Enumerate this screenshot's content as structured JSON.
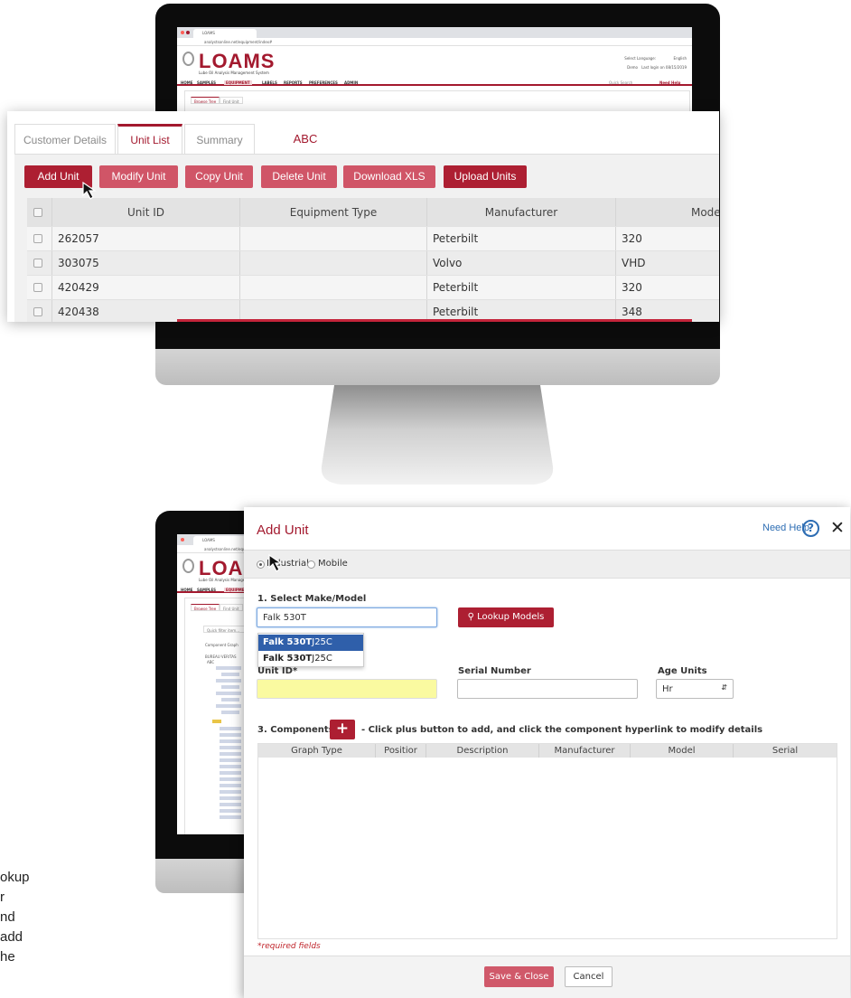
{
  "mini_browser": {
    "tab_label": "LOAMS",
    "url": "analystsonline.net/equipment/index#",
    "logo_text": "LOAMS",
    "logo_subtitle": "Lube Oil Analysis Management System",
    "language_label": "Select Language:",
    "language_value": "English",
    "user_label": "Demo",
    "last_login": "Last login on 08/15/2019",
    "quick_search": "Quick Search",
    "need_help": "Need Help",
    "nav": [
      "HOME",
      "SAMPLES",
      "EQUIPMENT",
      "LABELS",
      "REPORTS",
      "PREFERENCES",
      "ADMIN"
    ],
    "sub_tabs": [
      "Browse Tree",
      "Find Unit"
    ],
    "filter_placeholder": "Quick filter item...",
    "tree_root": "BUREAU VERITAS",
    "tree_abc": "ABC",
    "tree_compare": "Component Graph"
  },
  "unit_list": {
    "tabs": [
      "Customer Details",
      "Unit List",
      "Summary"
    ],
    "customer_name": "ABC",
    "buttons": [
      "Add Unit",
      "Modify Unit",
      "Copy Unit",
      "Delete Unit",
      "Download XLS",
      "Upload Units"
    ],
    "columns": [
      "Unit ID",
      "Equipment Type",
      "Manufacturer",
      "Model"
    ],
    "rows": [
      [
        "262057",
        "",
        "Peterbilt",
        "320"
      ],
      [
        "303075",
        "",
        "Volvo",
        "VHD"
      ],
      [
        "420429",
        "",
        "Peterbilt",
        "320"
      ],
      [
        "420438",
        "",
        "Peterbilt",
        "348"
      ]
    ]
  },
  "add_unit": {
    "title": "Add Unit",
    "need_help": "Need Help",
    "help_glyph": "?",
    "close_glyph": "✕",
    "radio_industrial": "Industrial",
    "radio_mobile": "Mobile",
    "section1": "1. Select Make/Model",
    "make_model_value": "Falk 530T",
    "lookup_button": "Lookup Models",
    "dropdown_options": [
      {
        "match": "Falk 530T",
        "rest": "J25C"
      },
      {
        "match": "Falk 530T",
        "rest": "J25C"
      }
    ],
    "unit_id_label": "Unit ID*",
    "serial_label": "Serial Number",
    "age_units_label": "Age Units",
    "age_units_value": "Hr",
    "section3": "3. Components",
    "components_hint": "- Click plus button to add, and click the component hyperlink to modify details",
    "component_columns": [
      "Graph Type",
      "Positior",
      "Description",
      "Manufacturer",
      "Model",
      "Serial"
    ],
    "required_note": "*required fields",
    "save_button": "Save & Close",
    "cancel_button": "Cancel"
  },
  "side_text": [
    "okup",
    "r",
    "nd",
    "add",
    "he"
  ],
  "colors": {
    "brand_red": "#ad1f32",
    "link_blue": "#2d6db3",
    "required_yellow": "#fafaa0"
  }
}
